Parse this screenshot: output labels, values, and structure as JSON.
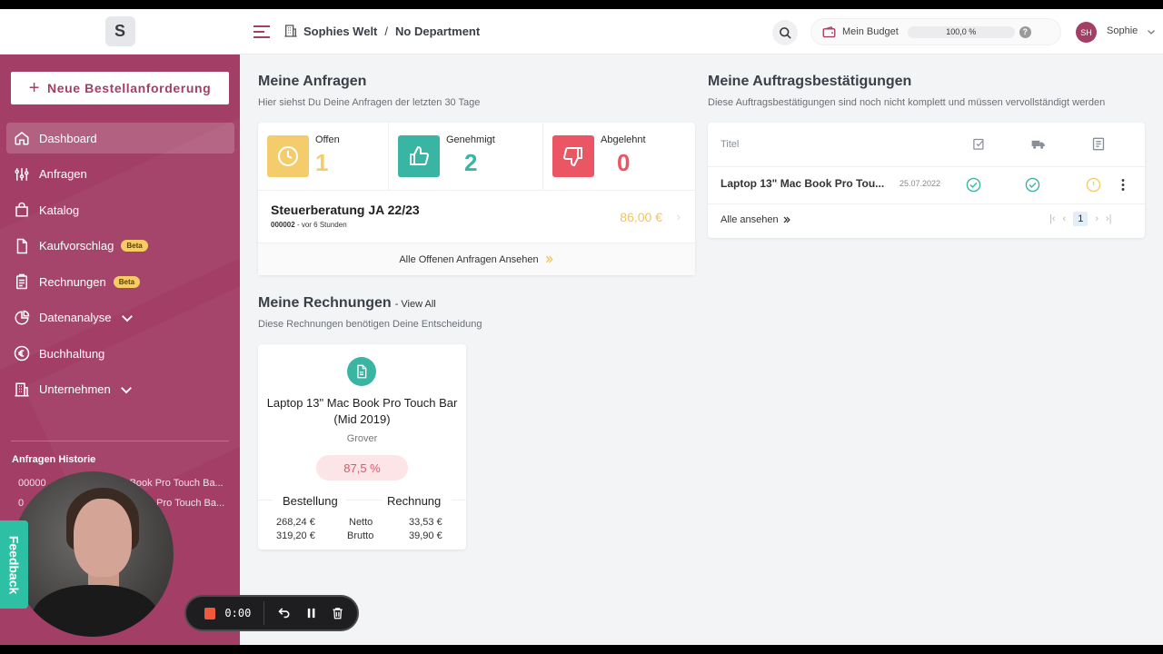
{
  "app": {
    "logo_letter": "S",
    "accent": "#a33f66"
  },
  "header": {
    "breadcrumb": [
      "Sophies Welt",
      "No Department"
    ],
    "breadcrumb_sep": "/",
    "budget_label": "Mein Budget",
    "budget_value": "100,0 %",
    "budget_help": "?",
    "user_initials": "SH",
    "user_name": "Sophie"
  },
  "sidebar": {
    "new_button": "Neue Bestellanforderung",
    "items": [
      {
        "label": "Dashboard",
        "icon": "home-icon",
        "active": true
      },
      {
        "label": "Anfragen",
        "icon": "sliders-icon"
      },
      {
        "label": "Katalog",
        "icon": "shopping-bag-icon"
      },
      {
        "label": "Kaufvorschlag",
        "icon": "document-icon",
        "badge": "Beta"
      },
      {
        "label": "Rechnungen",
        "icon": "clipboard-icon",
        "badge": "Beta"
      },
      {
        "label": "Datenanalyse",
        "icon": "pie-chart-icon",
        "expandable": true
      },
      {
        "label": "Buchhaltung",
        "icon": "euro-icon"
      },
      {
        "label": "Unternehmen",
        "icon": "building-icon",
        "expandable": true
      }
    ],
    "history_title": "Anfragen Historie",
    "history": [
      "00000",
      "0"
    ],
    "history_fragments": [
      "Book Pro Touch Ba...",
      "Pro Touch Ba..."
    ],
    "feedback": "Feedback"
  },
  "recorder": {
    "time": "0:00"
  },
  "requests": {
    "title": "Meine Anfragen",
    "subtitle": "Hier siehst Du Deine Anfragen der letzten 30 Tage",
    "stats": [
      {
        "label": "Offen",
        "value": "1",
        "color": "#f4cc6c",
        "icon": "clock-icon"
      },
      {
        "label": "Genehmigt",
        "value": "2",
        "color": "#3ab5a4",
        "icon": "thumbs-up-icon"
      },
      {
        "label": "Abgelehnt",
        "value": "0",
        "color": "#ea5664",
        "icon": "thumbs-down-icon"
      }
    ],
    "item": {
      "title": "Steuerberatung JA 22/23",
      "id": "000002",
      "age": "- vor 6 Stunden",
      "amount": "86,00 €"
    },
    "footer": "Alle Offenen Anfragen Ansehen"
  },
  "confirmations": {
    "title": "Meine Auftragsbestätigungen",
    "subtitle": "Diese Auftragsbestätigungen sind noch nicht komplett und müssen vervollständigt werden",
    "column_title": "Titel",
    "row": {
      "title": "Laptop 13\" Mac Book Pro Tou...",
      "date": "25.07.2022"
    },
    "see_all": "Alle ansehen",
    "page": "1"
  },
  "invoices": {
    "title": "Meine Rechnungen",
    "view_all": "- View All",
    "subtitle": "Diese Rechnungen benötigen Deine Entscheidung",
    "card": {
      "title": "Laptop 13\" Mac Book Pro Touch Bar (Mid 2019)",
      "vendor": "Grover",
      "percent": "87,5 %",
      "col_left": "Bestellung",
      "col_right": "Rechnung",
      "netto_label": "Netto",
      "brutto_label": "Brutto",
      "order_netto": "268,24 €",
      "order_brutto": "319,20 €",
      "invoice_netto": "33,53 €",
      "invoice_brutto": "39,90 €"
    }
  }
}
